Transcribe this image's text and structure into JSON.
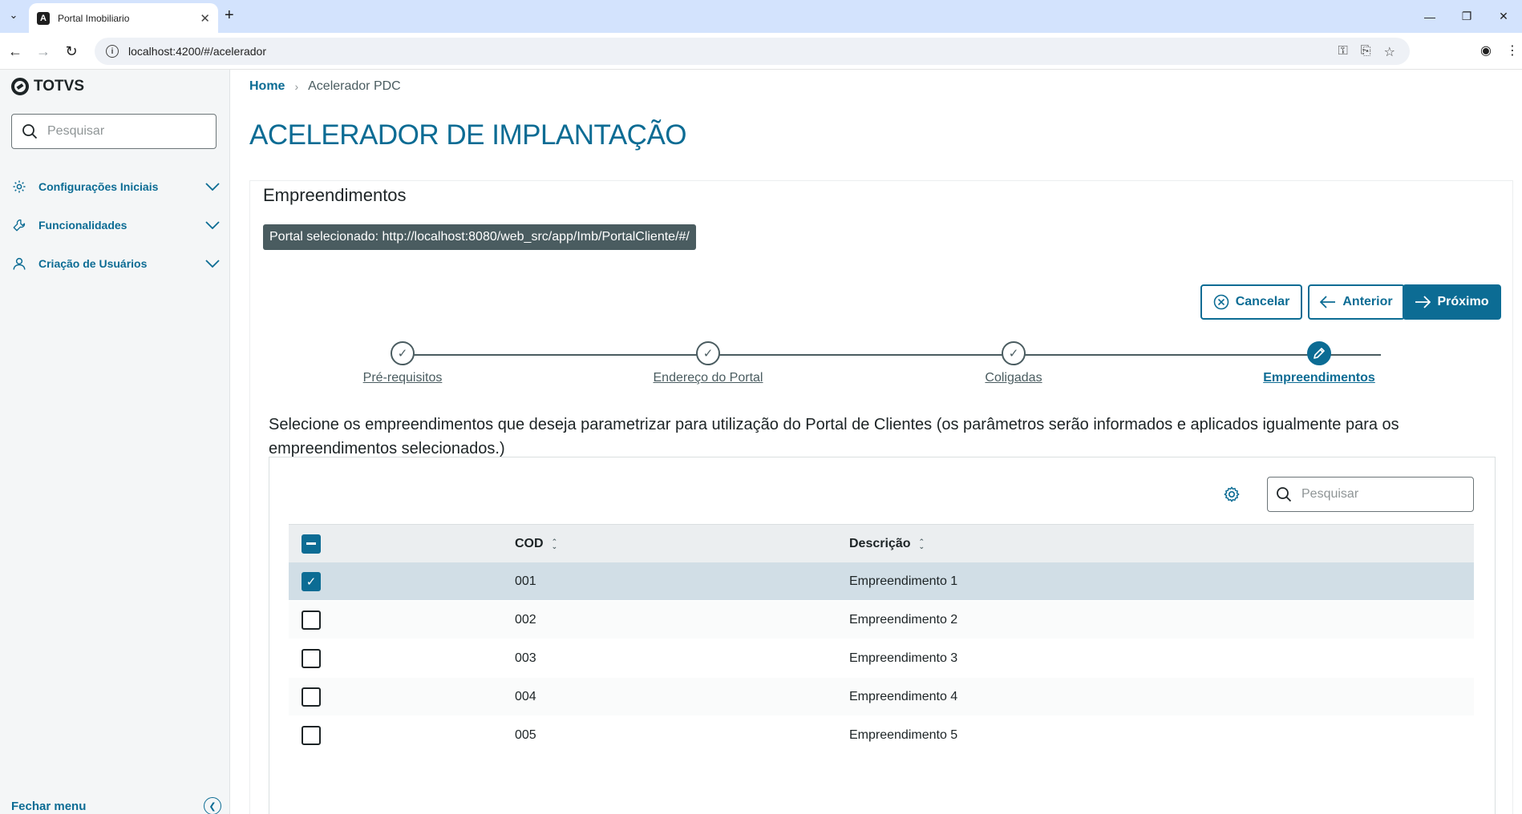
{
  "browser": {
    "tab_title": "Portal Imobiliario",
    "url": "localhost:4200/#/acelerador"
  },
  "sidebar": {
    "brand": "TOTVS",
    "search_placeholder": "Pesquisar",
    "items": [
      {
        "label": "Configurações Iniciais",
        "icon": "gear-icon"
      },
      {
        "label": "Funcionalidades",
        "icon": "wrench-icon"
      },
      {
        "label": "Criação de Usuários",
        "icon": "user-icon"
      }
    ],
    "footer_label": "Fechar menu"
  },
  "breadcrumb": {
    "home": "Home",
    "current": "Acelerador PDC"
  },
  "page": {
    "title": "ACELERADOR DE IMPLANTAÇÃO"
  },
  "card": {
    "title": "Empreendimentos",
    "portal_tag": "Portal selecionado: http://localhost:8080/web_src/app/Imb/PortalCliente/#/"
  },
  "actions": {
    "cancel": "Cancelar",
    "previous": "Anterior",
    "next": "Próximo"
  },
  "stepper": {
    "steps": [
      {
        "label": "Pré-requisitos",
        "state": "done"
      },
      {
        "label": "Endereço do Portal",
        "state": "done"
      },
      {
        "label": "Coligadas",
        "state": "done"
      },
      {
        "label": "Empreendimentos",
        "state": "active"
      }
    ]
  },
  "description": "Selecione os empreendimentos que deseja parametrizar para utilização do Portal de Clientes (os parâmetros serão informados e aplicados igualmente para os empreendimentos selecionados.)",
  "table": {
    "search_placeholder": "Pesquisar",
    "columns": [
      "COD",
      "Descrição"
    ],
    "rows": [
      {
        "cod": "001",
        "desc": "Empreendimento 1",
        "checked": true
      },
      {
        "cod": "002",
        "desc": "Empreendimento 2",
        "checked": false
      },
      {
        "cod": "003",
        "desc": "Empreendimento 3",
        "checked": false
      },
      {
        "cod": "004",
        "desc": "Empreendimento 4",
        "checked": false
      },
      {
        "cod": "005",
        "desc": "Empreendimento 5",
        "checked": false
      }
    ]
  },
  "colors": {
    "primary": "#0c6c94",
    "text": "#1d2426",
    "muted": "#4a5c60",
    "row_selected": "#d1dee6",
    "tab_bar": "#d3e3fd"
  }
}
